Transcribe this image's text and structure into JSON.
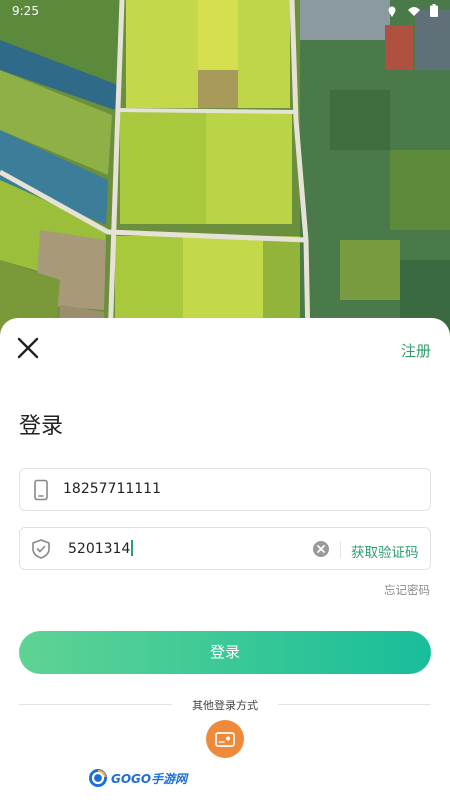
{
  "status_bar": {
    "time": "9:25"
  },
  "header": {
    "register_label": "注册"
  },
  "title": "登录",
  "phone_field": {
    "value": "18257711111"
  },
  "code_field": {
    "value": "5201314",
    "get_code_label": "获取验证码"
  },
  "forgot_password_label": "忘记密码",
  "login_button_label": "登录",
  "other_login_label": "其他登录方式",
  "watermark": {
    "text": "GOGO手游网"
  },
  "colors": {
    "accent": "#2e9e6b",
    "button_start": "#5fd394",
    "button_end": "#18be9a",
    "alt_login": "#f08a3b"
  },
  "icons": [
    "close-icon",
    "phone-icon",
    "shield-icon",
    "clear-icon",
    "id-card-icon"
  ]
}
